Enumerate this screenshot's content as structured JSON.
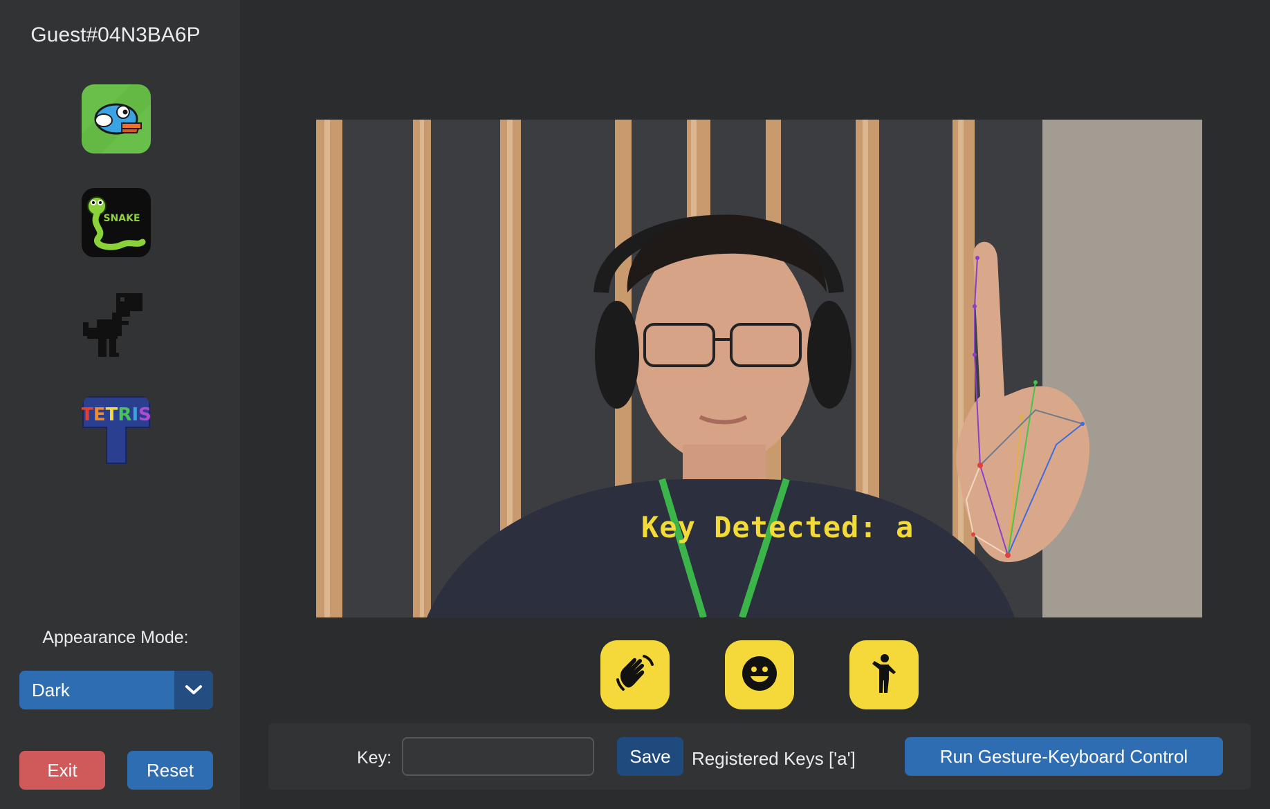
{
  "sidebar": {
    "user": "Guest#04N3BA6P",
    "games": [
      {
        "name": "flappy-bird-icon",
        "accent": "#6abf4b"
      },
      {
        "name": "snake-icon",
        "label": "SNAKE",
        "accent": "#8bd13a"
      },
      {
        "name": "dino-icon",
        "accent": "#1a1a1a"
      },
      {
        "name": "tetris-icon",
        "label": "TETRIS",
        "accent": "#2a3f8f"
      }
    ],
    "appearance_label": "Appearance Mode:",
    "appearance_value": "Dark",
    "exit_label": "Exit",
    "reset_label": "Reset"
  },
  "video": {
    "overlay": "Key Detected: a"
  },
  "gestures": [
    {
      "name": "wave-hand-icon"
    },
    {
      "name": "smile-face-icon"
    },
    {
      "name": "person-raising-hand-icon"
    }
  ],
  "controls": {
    "key_label": "Key:",
    "key_value": "",
    "save_label": "Save",
    "registered_text": "Registered Keys ['a']",
    "run_label": "Run Gesture-Keyboard Control"
  },
  "colors": {
    "accent": "#2f6db3",
    "danger": "#d05a5a",
    "gesture_yellow": "#f5d93a",
    "overlay_yellow": "#f2da38"
  }
}
